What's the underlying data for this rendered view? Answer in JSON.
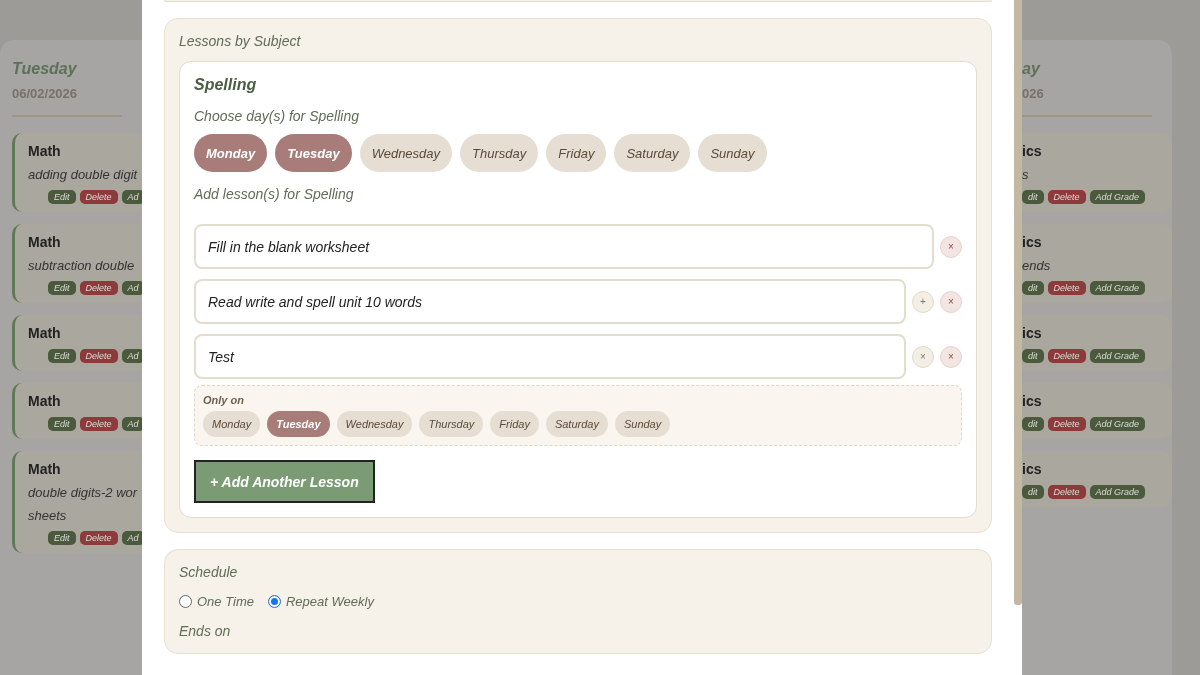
{
  "background_columns": [
    {
      "kind": "left",
      "title": "Tuesday",
      "date": "06/02/2026",
      "entries": [
        {
          "subject": "Math",
          "description": [
            "adding double digit"
          ],
          "buttons": [
            {
              "kind": "edit",
              "label": "Edit"
            },
            {
              "kind": "delete",
              "label": "Delete"
            },
            {
              "kind": "grade",
              "label": "Ad"
            }
          ]
        },
        {
          "subject": "Math",
          "description": [
            "subtraction double"
          ],
          "buttons": [
            {
              "kind": "edit",
              "label": "Edit"
            },
            {
              "kind": "delete",
              "label": "Delete"
            },
            {
              "kind": "grade",
              "label": "Ad"
            }
          ]
        },
        {
          "subject": "Math",
          "buttons": [
            {
              "kind": "edit",
              "label": "Edit"
            },
            {
              "kind": "delete",
              "label": "Delete"
            },
            {
              "kind": "grade",
              "label": "Ad"
            }
          ]
        },
        {
          "subject": "Math",
          "buttons": [
            {
              "kind": "edit",
              "label": "Edit"
            },
            {
              "kind": "delete",
              "label": "Delete"
            },
            {
              "kind": "grade",
              "label": "Ad"
            }
          ]
        },
        {
          "subject": "Math",
          "description": [
            "double digits-2 wor",
            "sheets"
          ],
          "buttons": [
            {
              "kind": "edit",
              "label": "Edit"
            },
            {
              "kind": "delete",
              "label": "Delete"
            },
            {
              "kind": "grade",
              "label": "Ad"
            }
          ]
        }
      ]
    },
    {
      "kind": "right",
      "title": "ay",
      "date": "026",
      "entries": [
        {
          "subject": "ics",
          "description": [
            "s"
          ],
          "buttons": [
            {
              "kind": "edit",
              "label": "dit"
            },
            {
              "kind": "delete",
              "label": "Delete"
            },
            {
              "kind": "grade",
              "label": "Add Grade"
            }
          ]
        },
        {
          "subject": "ics",
          "description": [
            "ends"
          ],
          "buttons": [
            {
              "kind": "edit",
              "label": "dit"
            },
            {
              "kind": "delete",
              "label": "Delete"
            },
            {
              "kind": "grade",
              "label": "Add Grade"
            }
          ]
        },
        {
          "subject": "ics",
          "buttons": [
            {
              "kind": "edit",
              "label": "dit"
            },
            {
              "kind": "delete",
              "label": "Delete"
            },
            {
              "kind": "grade",
              "label": "Add Grade"
            }
          ]
        },
        {
          "subject": "ics",
          "buttons": [
            {
              "kind": "edit",
              "label": "dit"
            },
            {
              "kind": "delete",
              "label": "Delete"
            },
            {
              "kind": "grade",
              "label": "Add Grade"
            }
          ]
        },
        {
          "subject": "ics",
          "buttons": [
            {
              "kind": "edit",
              "label": "dit"
            },
            {
              "kind": "delete",
              "label": "Delete"
            },
            {
              "kind": "grade",
              "label": "Add Grade"
            }
          ]
        }
      ]
    }
  ],
  "modal": {
    "lessons_section": {
      "heading": "Lessons by Subject",
      "subject": {
        "name": "Spelling",
        "days_label": "Choose day(s) for Spelling",
        "days": [
          {
            "label": "Monday",
            "selected": true
          },
          {
            "label": "Tuesday",
            "selected": true
          },
          {
            "label": "Wednesday",
            "selected": false
          },
          {
            "label": "Thursday",
            "selected": false
          },
          {
            "label": "Friday",
            "selected": false
          },
          {
            "label": "Saturday",
            "selected": false
          },
          {
            "label": "Sunday",
            "selected": false
          }
        ],
        "lessons_label": "Add lesson(s) for Spelling",
        "lessons": [
          {
            "value": "Fill in the blank worksheet",
            "actions": [
              {
                "kind": "remove",
                "label": "×"
              }
            ]
          },
          {
            "value": "Read write and spell unit 10 words",
            "actions": [
              {
                "kind": "limit",
                "label": "+"
              },
              {
                "kind": "remove",
                "label": "×"
              }
            ]
          },
          {
            "value": "Test",
            "actions": [
              {
                "kind": "limit",
                "label": "×"
              },
              {
                "kind": "remove",
                "label": "×"
              }
            ],
            "only_on": {
              "label": "Only on",
              "days": [
                {
                  "label": "Monday",
                  "selected": false
                },
                {
                  "label": "Tuesday",
                  "selected": true
                },
                {
                  "label": "Wednesday",
                  "selected": false
                },
                {
                  "label": "Thursday",
                  "selected": false
                },
                {
                  "label": "Friday",
                  "selected": false
                },
                {
                  "label": "Saturday",
                  "selected": false
                },
                {
                  "label": "Sunday",
                  "selected": false
                }
              ]
            }
          }
        ],
        "add_button": "+ Add Another Lesson"
      }
    },
    "schedule_section": {
      "heading": "Schedule",
      "options": [
        {
          "label": "One Time",
          "selected": false
        },
        {
          "label": "Repeat Weekly",
          "selected": true
        }
      ],
      "ends_label": "Ends on"
    }
  }
}
